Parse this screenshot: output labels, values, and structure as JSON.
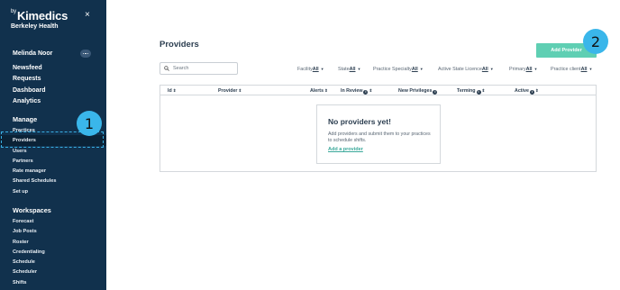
{
  "sidebar": {
    "brand_prefix": "by",
    "brand": "Kimedics",
    "org": "Berkeley Health",
    "close_icon": "×",
    "user_name": "Melinda Noor",
    "main_nav": [
      "Newsfeed",
      "Requests",
      "Dashboard",
      "Analytics"
    ],
    "manage_title": "Manage",
    "manage_items": [
      "Practices",
      "Providers",
      "Users",
      "Partners",
      "Rate manager",
      "Shared Schedules",
      "Set up"
    ],
    "workspaces_title": "Workspaces",
    "workspace_items": [
      "Forecast",
      "Job Posts",
      "Roster",
      "Credentialing",
      "Schedule",
      "Scheduler",
      "Shifts"
    ]
  },
  "badges": {
    "one": "1",
    "two": "2"
  },
  "main": {
    "title": "Providers",
    "add_button": "Add Provider",
    "search_placeholder": "Search",
    "filters": [
      {
        "label": "Facility",
        "value": "All"
      },
      {
        "label": "State",
        "value": "All"
      },
      {
        "label": "Practice Specialty",
        "value": "All"
      },
      {
        "label": "Active State Licence",
        "value": "All"
      },
      {
        "label": "Primary",
        "value": "All"
      },
      {
        "label": "Practice client",
        "value": "All"
      }
    ],
    "columns": [
      "Id",
      "Provider",
      "Alerts",
      "In Review",
      "New Privileges",
      "Terming",
      "Active"
    ],
    "empty": {
      "title": "No providers yet!",
      "text": "Add providers and submit them to your practices to schedule shifts.",
      "link": "Add a provider"
    }
  },
  "colors": {
    "sidebar": "#11314d",
    "accent": "#5fcfb3",
    "badge": "#3ab6ea"
  }
}
